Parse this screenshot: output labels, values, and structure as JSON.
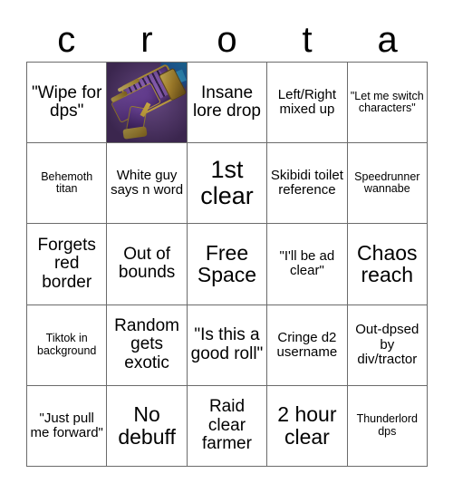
{
  "card": {
    "header_letters": [
      "c",
      "r",
      "o",
      "t",
      "a"
    ],
    "rows": [
      [
        {
          "text": "\"Wipe for dps\"",
          "size": "md",
          "type": "text"
        },
        {
          "text": "",
          "size": "md",
          "type": "image",
          "image_name": "destiny-weapon-art",
          "colors": {
            "background": "#5a3a78",
            "accent_gold": "#c9a338",
            "accent_blue": "#2ea7e0"
          }
        },
        {
          "text": "Insane lore drop",
          "size": "md",
          "type": "text"
        },
        {
          "text": "Left/Right mixed up",
          "size": "sm",
          "type": "text"
        },
        {
          "text": "\"Let me switch characters\"",
          "size": "xs",
          "type": "text"
        }
      ],
      [
        {
          "text": "Behemoth titan",
          "size": "xs",
          "type": "text"
        },
        {
          "text": "White guy says n word",
          "size": "sm",
          "type": "text"
        },
        {
          "text": "1st clear",
          "size": "xl",
          "type": "text"
        },
        {
          "text": "Skibidi toilet reference",
          "size": "sm",
          "type": "text"
        },
        {
          "text": "Speedrunner wannabe",
          "size": "xs",
          "type": "text"
        }
      ],
      [
        {
          "text": "Forgets red border",
          "size": "md",
          "type": "text"
        },
        {
          "text": "Out of bounds",
          "size": "md",
          "type": "text"
        },
        {
          "text": "Free Space",
          "size": "lg",
          "type": "text"
        },
        {
          "text": "\"I'll be ad clear\"",
          "size": "sm",
          "type": "text"
        },
        {
          "text": "Chaos reach",
          "size": "lg",
          "type": "text"
        }
      ],
      [
        {
          "text": "Tiktok in background",
          "size": "xs",
          "type": "text"
        },
        {
          "text": "Random gets exotic",
          "size": "md",
          "type": "text"
        },
        {
          "text": "\"Is this a good roll\"",
          "size": "md",
          "type": "text"
        },
        {
          "text": "Cringe d2 username",
          "size": "sm",
          "type": "text"
        },
        {
          "text": "Out-dpsed by div/tractor",
          "size": "sm",
          "type": "text"
        }
      ],
      [
        {
          "text": "\"Just pull me forward\"",
          "size": "sm",
          "type": "text"
        },
        {
          "text": "No debuff",
          "size": "lg",
          "type": "text"
        },
        {
          "text": "Raid clear farmer",
          "size": "md",
          "type": "text"
        },
        {
          "text": "2 hour clear",
          "size": "lg",
          "type": "text"
        },
        {
          "text": "Thunderlord dps",
          "size": "xs",
          "type": "text"
        }
      ]
    ]
  }
}
